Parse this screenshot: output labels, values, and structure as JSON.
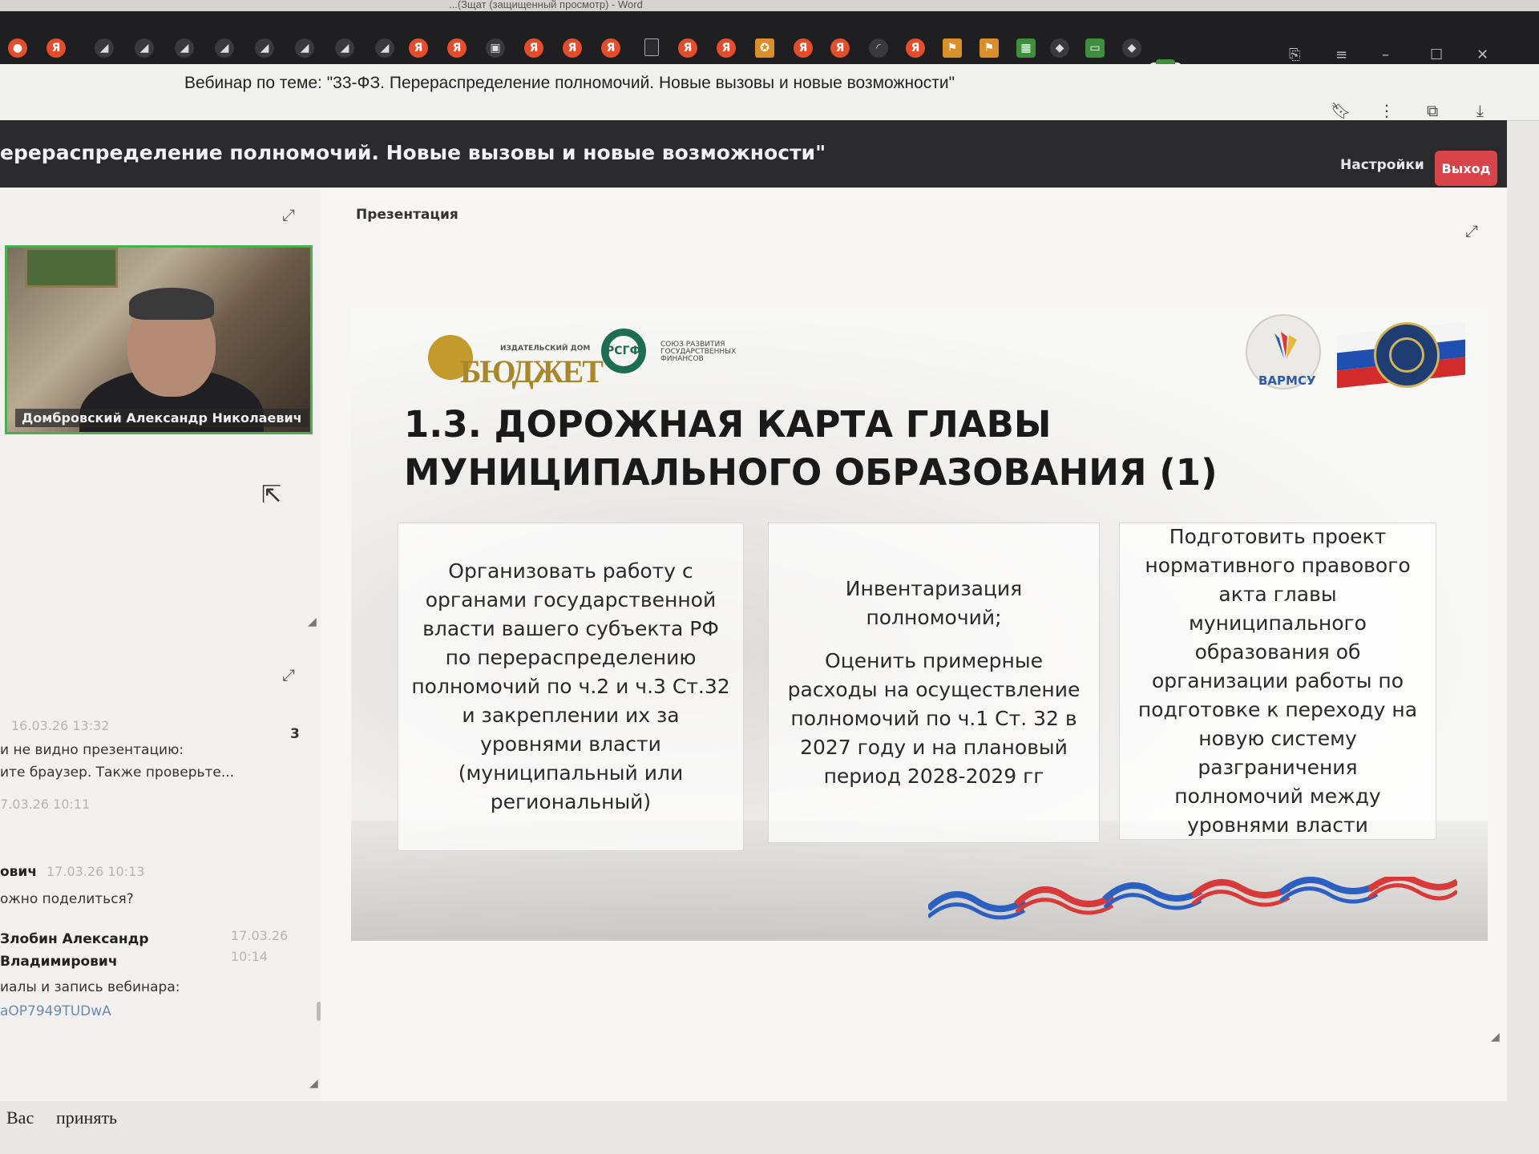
{
  "os": {
    "window_title": "...(Зщат (защищенный просмотр) - Word"
  },
  "browser": {
    "tab_title": "Вебинар по теме: \"33-ФЗ. Перераспределение полномочий. Новые вызовы и новые возможности\"",
    "new_tab_symbol": "+",
    "icons": [
      "bookmark-icon",
      "more-icon",
      "extensions-icon",
      "download-icon"
    ]
  },
  "webinar": {
    "title": "ерераспределение полномочий. Новые вызовы и новые возможности\"",
    "settings_label": "Настройки",
    "exit_label": "Выход",
    "presentation_label": "Презентация"
  },
  "speaker": {
    "name": "Домбровский Александр Николаевич"
  },
  "chat": {
    "count": "3",
    "messages": [
      {
        "time": "16.03.26 13:32",
        "lines": [
          "и не видно презентацию:",
          "ите браузер. Также проверьте..."
        ]
      },
      {
        "time": "7.03.26 10:11"
      },
      {
        "author": "ович",
        "time": "17.03.26 10:13",
        "text": "ожно поделиться?"
      },
      {
        "author_line1": "Злобин Александр",
        "author_line2": "Владимирович",
        "time_line1": "17.03.26",
        "time_line2": "10:14",
        "text": "иалы и запись вебинара:",
        "code": "aOP7949TUDwA"
      }
    ],
    "bottom_text_1": "Вас",
    "bottom_text_2": "принять"
  },
  "slide": {
    "logo_budget_small": "ИЗДАТЕЛЬСКИЙ ДОМ",
    "logo_budget_word": "БЮДЖЕТ",
    "logo_rsgf": "РСГФ",
    "logo_rsgf_sub": "СОЮЗ РАЗВИТИЯ ГОСУДАРСТВЕННЫХ ФИНАНСОВ",
    "logo_varmsu": "ВАРМСУ",
    "title": "1.3. ДОРОЖНАЯ КАРТА ГЛАВЫ МУНИЦИПАЛЬНОГО ОБРАЗОВАНИЯ (1)",
    "cards": [
      {
        "text": "Организовать работу с органами государственной власти вашего субъекта РФ по перераспределению полномочий по ч.2 и ч.3 Ст.32 и закреплении их за уровнями власти (муниципальный или региональный)"
      },
      {
        "text1": "Инвентаризация полномочий;",
        "text2": "Оценить примерные расходы на осуществление полномочий по ч.1 Ст. 32 в 2027 году и на плановый период 2028-2029 гг"
      },
      {
        "text": "Подготовить проект нормативного правового акта главы муниципального образования об организации работы по подготовке к переходу на новую систему разграничения полномочий между уровнями власти"
      }
    ],
    "colors": {
      "blue": "#2b5fc2",
      "red": "#d83a3a",
      "green": "#1d6e4e",
      "gold": "#a8862a"
    }
  }
}
